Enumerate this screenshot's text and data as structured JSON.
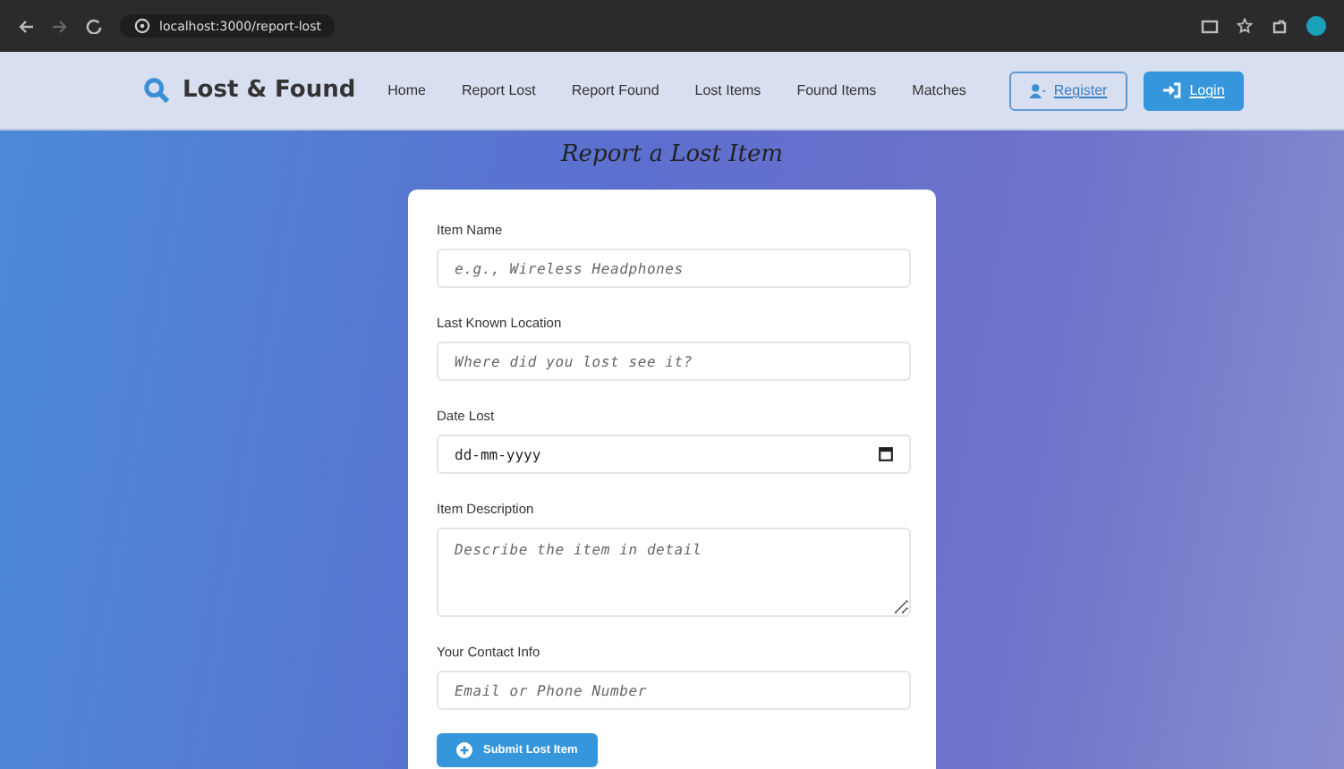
{
  "browser": {
    "url": "localhost:3000/report-lost"
  },
  "nav": {
    "brand": "Lost & Found",
    "links": [
      {
        "label": "Home"
      },
      {
        "label": "Report Lost"
      },
      {
        "label": "Report Found"
      },
      {
        "label": "Lost Items"
      },
      {
        "label": "Found Items"
      },
      {
        "label": "Matches"
      }
    ],
    "buttons": [
      {
        "label": "Register",
        "kind": "outline"
      },
      {
        "label": "Login",
        "kind": "primary"
      }
    ]
  },
  "page_title": "Report a Lost Item",
  "form": {
    "fields": [
      {
        "label": "Item Name",
        "kind": "text",
        "placeholder": "e.g., Wireless Headphones"
      },
      {
        "label": "Last Known Location",
        "kind": "text",
        "placeholder": "Where did you lost see it?"
      },
      {
        "label": "Date Lost",
        "kind": "date",
        "placeholder": "dd-mm-yyyy"
      },
      {
        "label": "Item Description",
        "kind": "textarea",
        "placeholder": "Describe the item in detail"
      },
      {
        "label": "Your Contact Info",
        "kind": "text",
        "placeholder": "Email or Phone Number"
      }
    ],
    "submit": "Submit Lost Item"
  }
}
